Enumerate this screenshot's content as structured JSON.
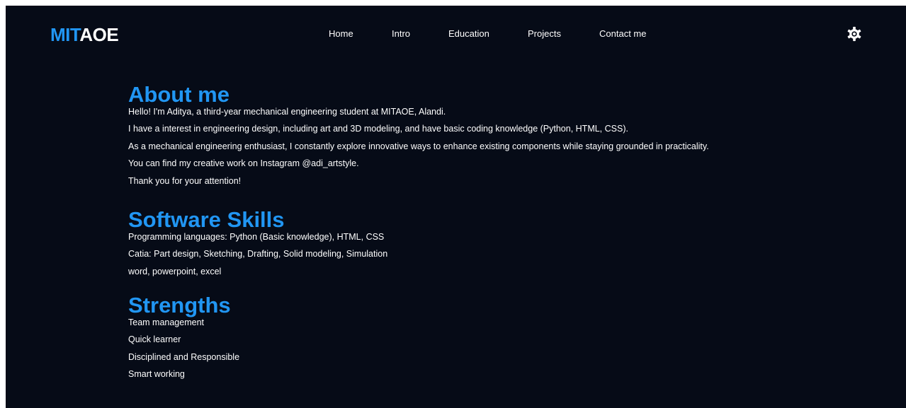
{
  "brand": {
    "accent": "MIT",
    "rest": "AOE"
  },
  "nav": {
    "home": "Home",
    "intro": "Intro",
    "education": "Education",
    "projects": "Projects",
    "contact": "Contact me"
  },
  "theme_toggle_icon": "gear-icon",
  "about": {
    "title": "About me",
    "lines": [
      "Hello! I'm Aditya, a third-year mechanical engineering student at MITAOE, Alandi.",
      "I have a interest in engineering design, including art and 3D modeling, and have basic coding knowledge (Python, HTML, CSS).",
      "As a mechanical engineering enthusiast, I constantly explore innovative ways to enhance existing components while staying grounded in practicality.",
      "You can find my creative work on Instagram @adi_artstyle.",
      "Thank you for your attention!"
    ]
  },
  "skills": {
    "title": "Software Skills",
    "lines": [
      "Programming languages: Python (Basic knowledge), HTML, CSS",
      "Catia: Part design, Sketching, Drafting, Solid modeling, Simulation",
      "word, powerpoint, excel"
    ]
  },
  "strengths": {
    "title": "Strengths",
    "lines": [
      "Team management",
      "Quick learner",
      "Disciplined and Responsible",
      "Smart working"
    ]
  },
  "colors": {
    "background": "#060b17",
    "accent": "#2196f3",
    "text": "#ffffff"
  }
}
